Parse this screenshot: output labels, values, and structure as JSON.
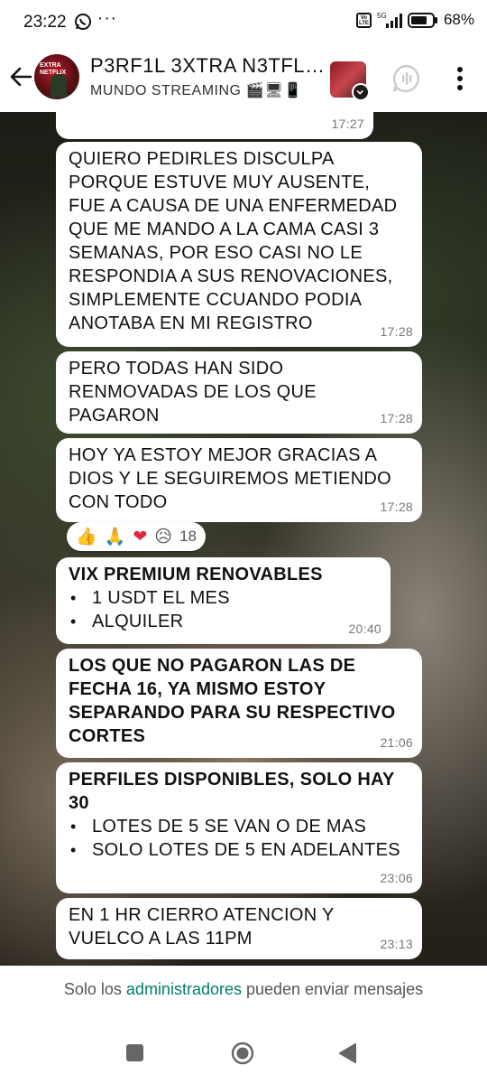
{
  "status_bar": {
    "time": "23:22",
    "dots": "···",
    "network": "5G",
    "battery": "68%"
  },
  "header": {
    "title": "P3RF1L 3XTRA N3TFL…",
    "subtitle": "MUNDO STREAMING",
    "subtitle_icons": "🎬🖥📱",
    "avatar_text": "EXTRA NETFLIX"
  },
  "messages": [
    {
      "text": "",
      "time": "17:27"
    },
    {
      "text": "QUIERO PEDIRLES DISCULPA PORQUE ESTUVE MUY AUSENTE, FUE A CAUSA DE UNA ENFERMEDAD QUE ME MANDO A LA CAMA CASI 3 SEMANAS, POR ESO CASI NO LE RESPONDIA A SUS RENOVACIONES, SIMPLEMENTE CCUANDO PODIA ANOTABA EN MI REGISTRO",
      "time": "17:28"
    },
    {
      "text": "PERO TODAS HAN SIDO RENMOVADAS DE LOS QUE PAGARON",
      "time": "17:28"
    },
    {
      "text": "HOY YA ESTOY MEJOR GRACIAS A DIOS Y LE SEGUIREMOS METIENDO CON TODO",
      "time": "17:28"
    },
    {
      "text": "VIX PREMIUM RENOVABLES",
      "bullets": [
        "1 USDT EL MES",
        "ALQUILER"
      ],
      "time": "20:40"
    },
    {
      "text": "LOS QUE NO PAGARON LAS DE FECHA 16, YA MISMO ESTOY SEPARANDO PARA SU RESPECTIVO CORTES",
      "time": "21:06"
    },
    {
      "text": "PERFILES DISPONIBLES, SOLO HAY 30",
      "bullets": [
        "LOTES DE 5 SE VAN O DE MAS",
        "SOLO LOTES DE 5 EN ADELANTES"
      ],
      "time": "23:06"
    },
    {
      "text": "EN 1 HR CIERRO ATENCION Y VUELCO A LAS 11PM",
      "time": "23:13"
    }
  ],
  "reactions": {
    "emojis": [
      "👍",
      "🙏",
      "❤",
      "😥"
    ],
    "count": "18"
  },
  "footer": {
    "before": "Solo los ",
    "link": "administradores",
    "after": " pueden enviar mensajes"
  },
  "colors": {
    "link": "#008069",
    "bubble": "#ffffff",
    "time": "#777777"
  }
}
